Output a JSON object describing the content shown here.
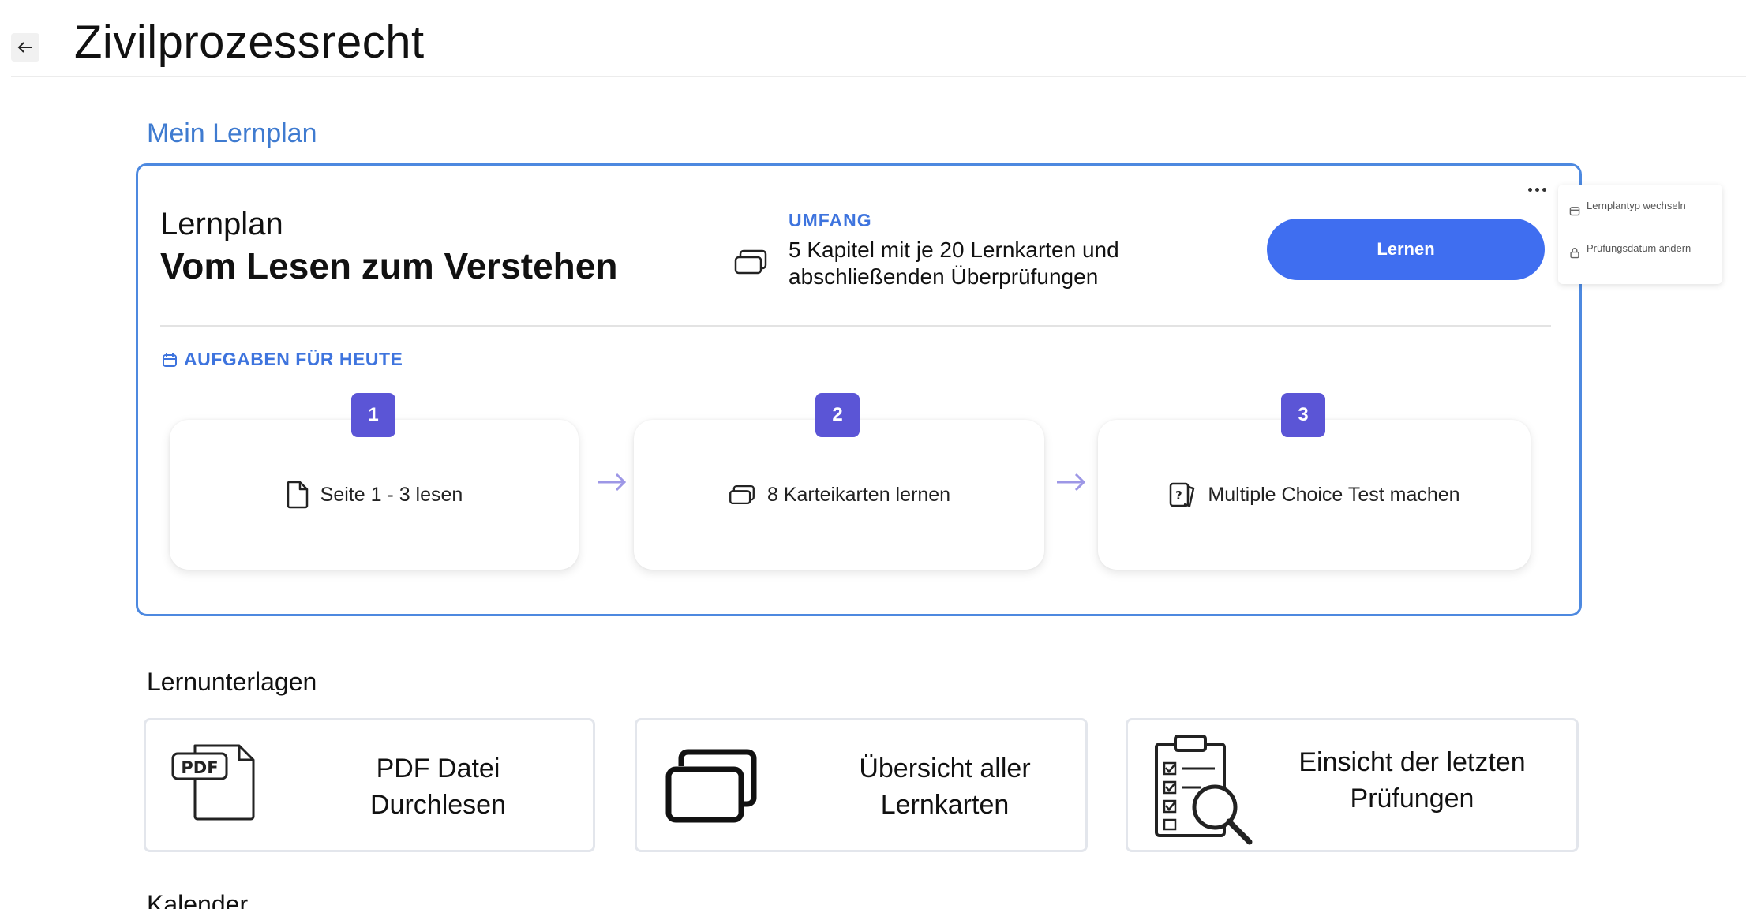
{
  "header": {
    "title": "Zivilprozessrecht",
    "back_icon": "arrow-left-icon"
  },
  "lernplan_section": {
    "title": "Mein Lernplan",
    "card": {
      "label": "Lernplan",
      "name": "Vom Lesen zum Verstehen",
      "scope_heading": "UMFANG",
      "scope_text": "5 Kapitel mit je 20 Lernkarten und abschließenden Überprüfungen",
      "learn_button": "Lernen",
      "tasks_heading": "AUFGABEN FÜR HEUTE",
      "tasks": [
        {
          "number": "1",
          "label": "Seite 1 - 3 lesen",
          "icon": "document-icon"
        },
        {
          "number": "2",
          "label": "8 Karteikarten lernen",
          "icon": "flashcards-icon"
        },
        {
          "number": "3",
          "label": "Multiple Choice Test machen",
          "icon": "quiz-cards-icon"
        }
      ]
    },
    "menu": {
      "items": [
        {
          "label": "Lernplantyp wechseln",
          "icon": "calendar-icon"
        },
        {
          "label": "Prüfungsdatum ändern",
          "icon": "lock-icon"
        }
      ]
    }
  },
  "materials_section": {
    "title": "Lernunterlagen",
    "cards": [
      {
        "label_line1": "PDF Datei",
        "label_line2": "Durchlesen",
        "icon_text": "PDF"
      },
      {
        "label_line1": "Übersicht aller",
        "label_line2": "Lernkarten"
      },
      {
        "label_line1": "Einsicht der letzten",
        "label_line2": "Prüfungen"
      }
    ]
  },
  "calendar_section": {
    "title": "Kalender"
  },
  "colors": {
    "accent": "#3e74de",
    "button": "#3f6ef0",
    "badge": "#5b55d6",
    "card_border": "#4d89e0"
  }
}
